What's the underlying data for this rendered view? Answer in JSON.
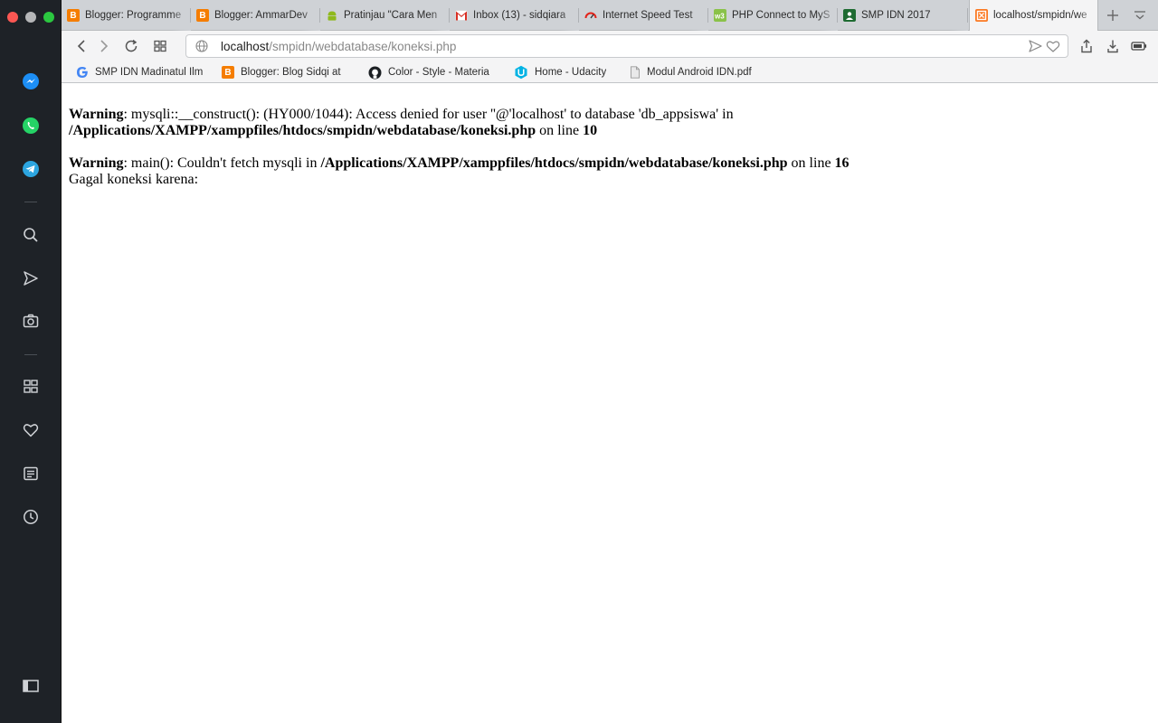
{
  "tabs": [
    {
      "label": "Blogger: Programme",
      "icon": "blogger-icon"
    },
    {
      "label": "Blogger: AmmarDev",
      "icon": "blogger-icon"
    },
    {
      "label": "Pratinjau \"Cara Men",
      "icon": "android-icon"
    },
    {
      "label": "Inbox (13) - sidqiara",
      "icon": "gmail-icon"
    },
    {
      "label": "Internet Speed Test",
      "icon": "speedtest-icon"
    },
    {
      "label": "PHP Connect to MyS",
      "icon": "w3schools-icon"
    },
    {
      "label": "SMP IDN 2017",
      "icon": "classroom-icon"
    },
    {
      "label": "localhost/smpidn/we",
      "icon": "xampp-icon"
    }
  ],
  "address": {
    "host": "localhost",
    "path": "/smpidn/webdatabase/koneksi.php"
  },
  "bookmarks": [
    {
      "label": "SMP IDN Madinatul Ilm",
      "icon": "google-icon"
    },
    {
      "label": "Blogger: Blog Sidqi at",
      "icon": "blogger-icon"
    },
    {
      "label": "Color - Style - Materia",
      "icon": "github-icon"
    },
    {
      "label": "Home - Udacity",
      "icon": "udacity-icon"
    },
    {
      "label": "Modul Android IDN.pdf",
      "icon": "file-icon"
    }
  ],
  "page": {
    "warning1": {
      "prefix": "Warning",
      "message": ": mysqli::__construct(): (HY000/1044): Access denied for user ''@'localhost' to database 'db_appsiswa' in",
      "path": "/Applications/XAMPP/xamppfiles/htdocs/smpidn/webdatabase/koneksi.php",
      "online": " on line ",
      "line": "10"
    },
    "warning2": {
      "prefix": "Warning",
      "message": ": main(): Couldn't fetch mysqli in ",
      "path": "/Applications/XAMPP/xamppfiles/htdocs/smpidn/webdatabase/koneksi.php",
      "online": " on line ",
      "line": "16"
    },
    "status": "Gagal koneksi karena:"
  },
  "colors": {
    "sidebar": "#1e2227",
    "tabstrip": "#cfd2d6",
    "toolbar": "#f4f4f5",
    "blogger": "#f57d00"
  }
}
